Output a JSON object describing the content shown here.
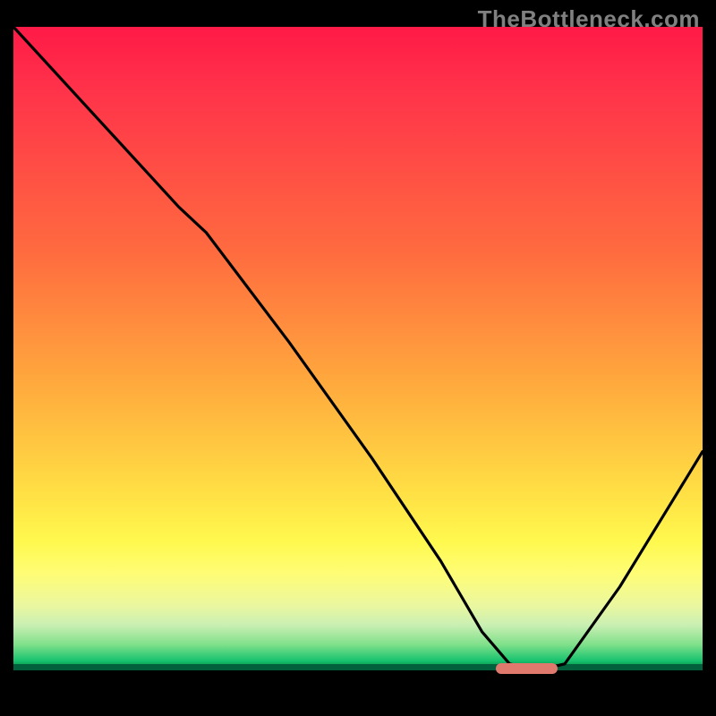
{
  "watermark": "TheBottleneck.com",
  "colors": {
    "curve": "#000000",
    "marker": "#e0796d",
    "grad_top": "#ff1a47",
    "grad_mid": "#ffde44",
    "grad_green": "#18c36f"
  },
  "chart_data": {
    "type": "line",
    "title": "",
    "xlabel": "",
    "ylabel": "",
    "xlim": [
      0,
      100
    ],
    "ylim": [
      0,
      100
    ],
    "series": [
      {
        "name": "bottleneck-curve",
        "x": [
          0,
          12,
          24,
          28,
          40,
          52,
          62,
          68,
          72,
          76,
          80,
          88,
          96,
          100
        ],
        "y": [
          100,
          86,
          72,
          68,
          51,
          33,
          17,
          6,
          1,
          0,
          1,
          13,
          27,
          34
        ]
      }
    ],
    "optimal_range_x": [
      70,
      79
    ],
    "notes": "y is bottleneck % (0 = no bottleneck at green baseline, 100 = red top). Values estimated from pixel positions; axes have no ticks or labels in the source image."
  }
}
